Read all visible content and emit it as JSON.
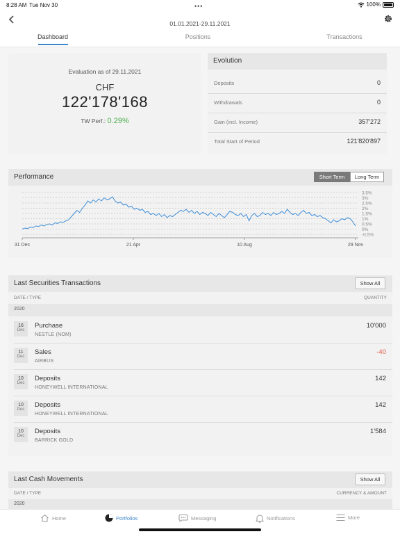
{
  "status_bar": {
    "time": "8:28 AM",
    "date": "Tue Nov 30",
    "battery": "100%"
  },
  "header": {
    "period": "01.01.2021-29.11.2021",
    "dots": "•••"
  },
  "tabs": [
    {
      "label": "Dashboard"
    },
    {
      "label": "Positions"
    },
    {
      "label": "Transactions"
    }
  ],
  "evaluation": {
    "title": "Evaluation as of 29.11.2021",
    "currency": "CHF",
    "amount": "122'178'168",
    "tw_label": "TW Perf.:",
    "tw_value": "0.29%"
  },
  "evolution": {
    "title": "Evolution",
    "rows": [
      {
        "label": "Deposits",
        "value": "0"
      },
      {
        "label": "Withdrawals",
        "value": "0"
      },
      {
        "label": "Gain (incl. Income)",
        "value": "357'272"
      },
      {
        "label": "Total Start of Period",
        "value": "121'820'897"
      }
    ]
  },
  "performance": {
    "title": "Performance",
    "short_term": "Short Term",
    "long_term": "Long Term"
  },
  "chart_data": {
    "type": "line",
    "x_ticks": [
      "31 Dec",
      "21 Apr",
      "10 Aug",
      "29 Nov"
    ],
    "y_ticks": [
      "3.5%",
      "3%",
      "2.5%",
      "2%",
      "1.5%",
      "1%",
      "0.5%",
      "0%",
      "-0.5%"
    ],
    "ylim": [
      -0.5,
      3.5
    ],
    "series": [
      {
        "values": [
          0.0,
          0.1,
          0.05,
          0.2,
          0.15,
          0.3,
          0.25,
          0.4,
          0.3,
          0.45,
          0.5,
          0.4,
          0.6,
          0.55,
          0.7,
          0.65,
          0.8,
          0.9,
          1.2,
          1.5,
          1.8,
          1.6,
          2.0,
          2.3,
          2.7,
          2.5,
          2.8,
          2.6,
          2.9,
          2.7,
          3.0,
          2.8,
          2.9,
          3.1,
          2.7,
          2.5,
          2.6,
          2.3,
          2.4,
          2.1,
          2.2,
          1.9,
          2.0,
          1.8,
          1.9,
          1.6,
          1.7,
          1.4,
          1.5,
          1.3,
          1.5,
          1.2,
          1.4,
          1.1,
          1.3,
          1.2,
          1.4,
          1.6,
          1.8,
          1.7,
          1.9,
          1.6,
          1.8,
          1.5,
          1.7,
          1.4,
          1.6,
          1.5,
          1.3,
          1.6,
          1.4,
          1.2,
          1.5,
          1.3,
          1.1,
          1.4,
          1.7,
          1.6,
          1.4,
          1.3,
          1.5,
          1.2,
          1.4,
          0.8,
          1.3,
          1.5,
          1.2,
          1.3,
          1.6,
          1.4,
          1.5,
          1.3,
          1.6,
          1.4,
          1.5,
          1.7,
          1.5,
          1.9,
          1.6,
          1.4,
          1.5,
          1.3,
          1.6,
          1.8,
          1.5,
          1.6,
          1.3,
          1.4,
          1.2,
          1.3,
          1.1,
          1.0,
          0.8,
          0.6,
          0.9,
          0.7,
          0.8,
          1.0,
          0.9,
          1.1,
          1.0,
          0.7,
          0.3
        ],
        "color": "#3e8ed8"
      }
    ]
  },
  "securities": {
    "title": "Last Securities Transactions",
    "show_all": "Show All",
    "col_left": "DATE / TYPE",
    "col_right": "QUANTITY",
    "year": "2020",
    "rows": [
      {
        "day": "16",
        "month": "Dec",
        "title": "Purchase",
        "sub": "NESTLE (NOM)",
        "qty": "10'000",
        "negative": false
      },
      {
        "day": "11",
        "month": "Dec",
        "title": "Sales",
        "sub": "AIRBUS",
        "qty": "-40",
        "negative": true
      },
      {
        "day": "10",
        "month": "Dec",
        "title": "Deposits",
        "sub": "HONEYWELL INTERNATIONAL",
        "qty": "142",
        "negative": false
      },
      {
        "day": "10",
        "month": "Dec",
        "title": "Deposits",
        "sub": "HONEYWELL INTERNATIONAL",
        "qty": "142",
        "negative": false
      },
      {
        "day": "10",
        "month": "Dec",
        "title": "Deposits",
        "sub": "BARRICK GOLD",
        "qty": "1'584",
        "negative": false
      }
    ]
  },
  "cash": {
    "title": "Last Cash Movements",
    "show_all": "Show All",
    "col_left": "DATE / TYPE",
    "col_right": "CURRENCY & AMOUNT",
    "year": "2020"
  },
  "bottom_nav": [
    {
      "label": "Home",
      "icon": "home-icon"
    },
    {
      "label": "Portfolios",
      "icon": "pie-chart-icon"
    },
    {
      "label": "Messaging",
      "icon": "chat-bubble-icon"
    },
    {
      "label": "Notifications",
      "icon": "bell-icon"
    },
    {
      "label": "More",
      "icon": "menu-icon"
    }
  ],
  "colors": {
    "accent": "#3e86c7",
    "positive": "#4caf50",
    "negative": "#e05a4a",
    "chart_line": "#3e8ed8"
  }
}
